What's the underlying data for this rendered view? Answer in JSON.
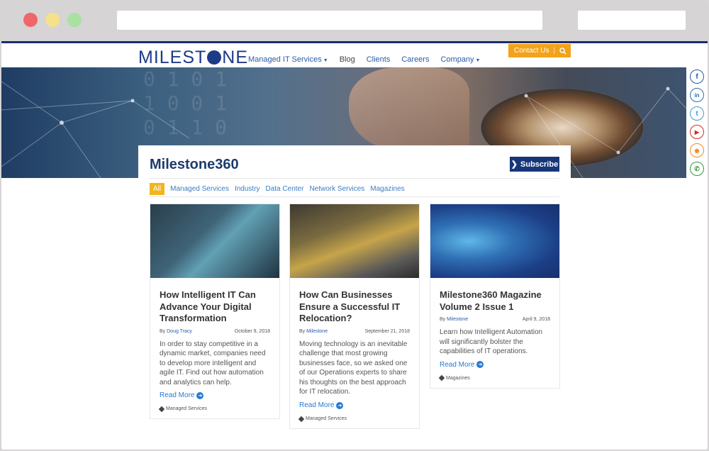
{
  "header": {
    "logo_text": "MILESTONE",
    "nav": [
      {
        "label": "Managed IT Services",
        "dropdown": true
      },
      {
        "label": "Blog",
        "dropdown": false
      },
      {
        "label": "Clients",
        "dropdown": false
      },
      {
        "label": "Careers",
        "dropdown": false
      },
      {
        "label": "Company",
        "dropdown": true
      }
    ],
    "contact_label": "Contact Us",
    "search_icon": "search-icon"
  },
  "social": [
    "facebook-icon",
    "linkedin-icon",
    "twitter-icon",
    "youtube-icon",
    "rss-icon",
    "phone-icon"
  ],
  "blog": {
    "title": "Milestone360",
    "subscribe_label": "Subscribe",
    "filters": [
      "All",
      "Managed Services",
      "Industry",
      "Data Center",
      "Network Services",
      "Magazines"
    ],
    "active_filter": "All"
  },
  "cards": [
    {
      "title": "How Intelligent IT Can Advance Your Digital Transformation",
      "by": "By",
      "author": "Doug Tracy",
      "date": "October 9, 2018",
      "excerpt": "In order to stay competitive in a dynamic market, companies need to develop more intelligent and agile IT. Find out how automation and analytics can help.",
      "read_more": "Read More",
      "tag": "Managed Services"
    },
    {
      "title": "How Can Businesses Ensure a Successful IT Relocation?",
      "by": "By",
      "author": "Milestone",
      "date": "September 21, 2018",
      "excerpt": "Moving technology is an inevitable challenge that most growing businesses face, so we asked one of our Operations experts to share his thoughts on the best approach for IT relocation.",
      "read_more": "Read More",
      "tag": "Managed Services"
    },
    {
      "title": "Milestone360 Magazine Volume 2 Issue 1",
      "by": "By",
      "author": "Milestone",
      "date": "April 9, 2018",
      "excerpt": "Learn how Intelligent Automation will significantly bolster the capabilities of IT operations.",
      "read_more": "Read More",
      "tag": "Magazines"
    }
  ],
  "colors": {
    "brand_navy": "#1b2d6b",
    "accent_orange": "#f2a31b",
    "link_blue": "#2a7ad0"
  }
}
